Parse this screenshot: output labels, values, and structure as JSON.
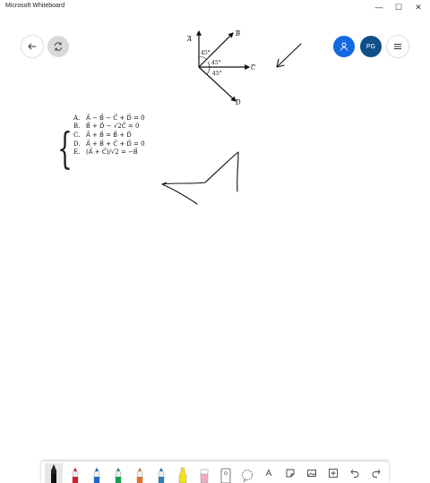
{
  "window": {
    "title": "Microsoft Whiteboard",
    "minimize_glyph": "—",
    "maximize_glyph": "☐",
    "close_glyph": "✕"
  },
  "header": {
    "avatar_initials": "PG"
  },
  "diagram": {
    "vector_labels": [
      "A",
      "B",
      "C",
      "D"
    ],
    "angle_labels": [
      "45°",
      "45°",
      "45°"
    ]
  },
  "options": [
    {
      "letter": "A.",
      "text": "A⃗ − B⃗ − C⃗ + D⃗ = 0"
    },
    {
      "letter": "B.",
      "text": "B⃗ + D⃗ − √2C⃗ = 0"
    },
    {
      "letter": "C.",
      "text": "A⃗ + B⃗ = B⃗ + D⃗"
    },
    {
      "letter": "D.",
      "text": "A⃗ + B⃗ + C⃗ + D⃗ = 0"
    },
    {
      "letter": "E.",
      "text": "(A⃗ + C⃗)/√2 = −B⃗"
    }
  ],
  "toolbar": {
    "tools": [
      {
        "name": "pen-black",
        "color": "#111111"
      },
      {
        "name": "pen-red",
        "color": "#d21f2b"
      },
      {
        "name": "pen-blue",
        "color": "#1f64c8"
      },
      {
        "name": "pen-green",
        "color": "#1a9b50"
      },
      {
        "name": "pen-orange",
        "color": "#e0702a"
      },
      {
        "name": "pen-teal",
        "color": "#2c7fb8"
      },
      {
        "name": "highlighter-yellow",
        "color": "#f4e11a"
      },
      {
        "name": "eraser",
        "color": "#f0a9c8"
      },
      {
        "name": "ruler",
        "color": "#666666"
      },
      {
        "name": "lasso",
        "color": "#555555"
      }
    ],
    "text_tool_glyph": "A"
  },
  "colors": {
    "share_button": "#1569e0",
    "avatar": "#0f4f8a",
    "ink": "#111111"
  }
}
